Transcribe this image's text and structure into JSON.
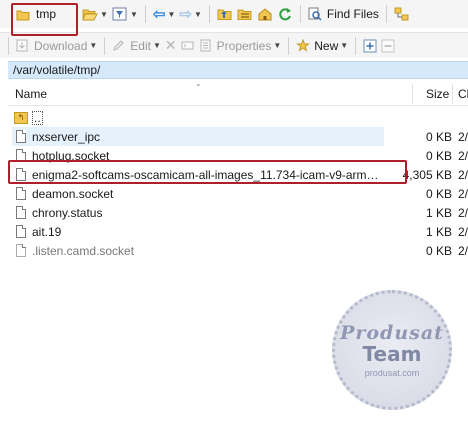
{
  "toolbar": {
    "location_label": "tmp",
    "find_files_label": "Find Files"
  },
  "toolbar2": {
    "download_label": "Download",
    "edit_label": "Edit",
    "properties_label": "Properties",
    "new_label": "New"
  },
  "path": "/var/volatile/tmp/",
  "columns": {
    "name": "Name",
    "size": "Size",
    "date": "Cl"
  },
  "parent_label": "..",
  "files": [
    {
      "name": "nxserver_ipc",
      "size": "0 KB",
      "date": "2/"
    },
    {
      "name": "hotplug.socket",
      "size": "0 KB",
      "date": "2/"
    },
    {
      "name": "enigma2-softcams-oscamicam-all-images_11.734-icam-v9-arm…",
      "size": "4,305 KB",
      "date": "2/"
    },
    {
      "name": "deamon.socket",
      "size": "0 KB",
      "date": "2/"
    },
    {
      "name": "chrony.status",
      "size": "1 KB",
      "date": "2/"
    },
    {
      "name": "ait.19",
      "size": "1 KB",
      "date": "2/"
    },
    {
      "name": ".listen.camd.socket",
      "size": "0 KB",
      "date": "2/"
    }
  ],
  "watermark": {
    "line1": "Produsat",
    "line2": "Team",
    "line3": "produsat.com"
  },
  "colors": {
    "highlight_red": "#b01e2a",
    "path_bar_blue": "#d6e9fb",
    "folder_yellow": "#f3c74f"
  }
}
